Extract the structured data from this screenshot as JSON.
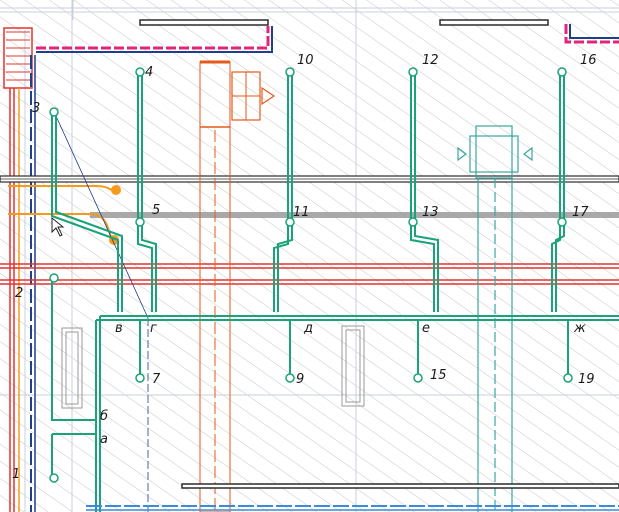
{
  "drawing": {
    "colors": {
      "hatch": "#b9b9b9",
      "grid_line": "#c8d0dc",
      "wall_dark": "#2b2b2b",
      "water_green": "#1aa37a",
      "heat_red": "#e3342f",
      "orange_pipe": "#f59a1b",
      "orange_red_duct": "#e55a1a",
      "magenta_pipe": "#e0267a",
      "navy_pipe": "#1d3f8c",
      "blue_pipe": "#3a8bd9",
      "teal_duct": "#3aa7a0",
      "grey_band": "#9a9a9a"
    },
    "riser_labels": [
      "4",
      "10",
      "12",
      "16",
      "5",
      "11",
      "13",
      "17",
      "7",
      "9",
      "15",
      "19",
      "1",
      "2",
      "3"
    ],
    "branch_labels": [
      "в",
      "г",
      "д",
      "е",
      "ж",
      "б",
      "а"
    ]
  }
}
